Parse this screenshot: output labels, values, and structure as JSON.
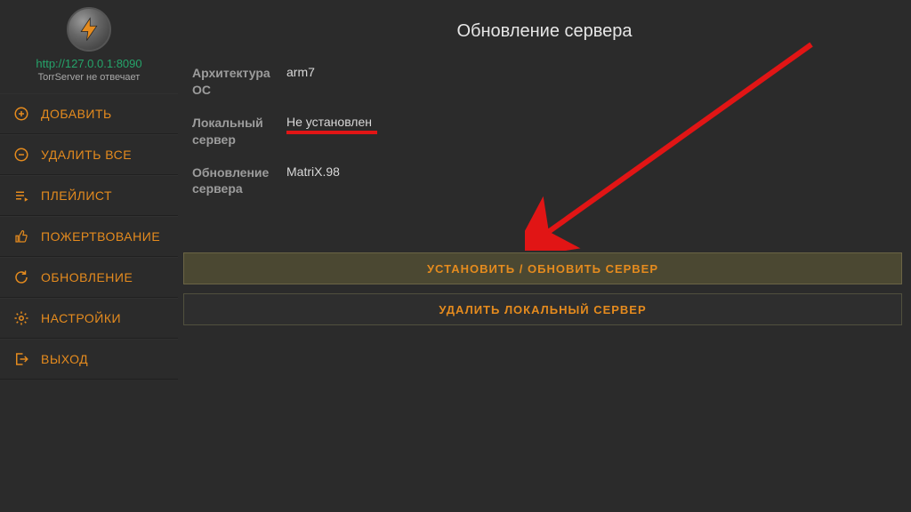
{
  "sidebar": {
    "server_url": "http://127.0.0.1:8090",
    "server_status": "TorrServer не отвечает",
    "items": [
      {
        "label": "ДОБАВИТЬ",
        "icon": "plus-circle-icon"
      },
      {
        "label": "УДАЛИТЬ ВСЕ",
        "icon": "minus-circle-icon"
      },
      {
        "label": "ПЛЕЙЛИСТ",
        "icon": "playlist-icon"
      },
      {
        "label": "ПОЖЕРТВОВАНИЕ",
        "icon": "thumbs-up-icon"
      },
      {
        "label": "ОБНОВЛЕНИЕ",
        "icon": "refresh-icon"
      },
      {
        "label": "НАСТРОЙКИ",
        "icon": "gear-icon"
      },
      {
        "label": "ВЫХОД",
        "icon": "exit-icon"
      }
    ]
  },
  "main": {
    "title": "Обновление сервера",
    "rows": [
      {
        "label": "Архитектура ОС",
        "value": "arm7"
      },
      {
        "label": "Локальный сервер",
        "value": "Не установлен"
      },
      {
        "label": "Обновление сервера",
        "value": "MatriX.98"
      }
    ],
    "buttons": {
      "install_update": "УСТАНОВИТЬ / ОБНОВИТЬ СЕРВЕР",
      "delete_local": "УДАЛИТЬ ЛОКАЛЬНЫЙ СЕРВЕР"
    }
  },
  "colors": {
    "accent": "#e58b1e",
    "annotation": "#e11515",
    "link": "#25a36a"
  }
}
